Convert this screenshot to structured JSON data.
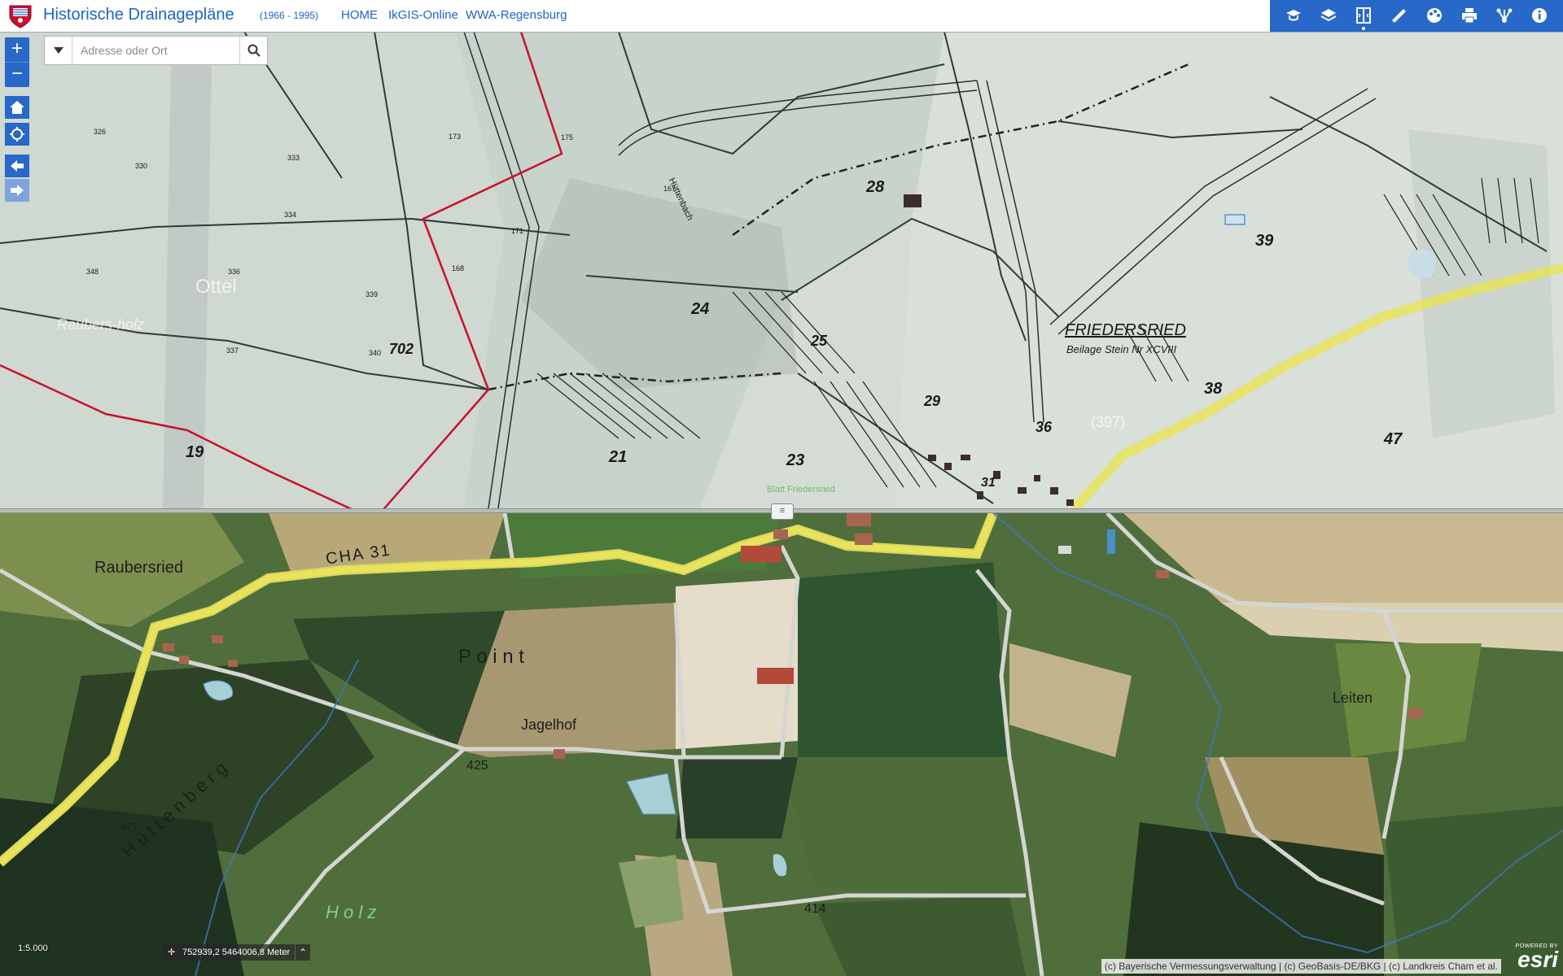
{
  "header": {
    "title": "Historische Drainagepläne",
    "subtitle": "(1966 - 1995)",
    "links": [
      "HOME",
      "IkGIS-Online",
      "WWA-Regensburg"
    ]
  },
  "toolbar": {
    "icons": [
      "legend-icon",
      "layers-icon",
      "swipe-icon",
      "measure-icon",
      "basemap-icon",
      "print-icon",
      "share-icon",
      "info-icon"
    ]
  },
  "search": {
    "placeholder": "Adresse oder Ort"
  },
  "zoom": {
    "in": "+",
    "out": "−"
  },
  "map_top": {
    "labels": [
      "FRIEDERSRIED",
      "Beilage Stein Nr XCVIII",
      "702",
      "24",
      "28",
      "29",
      "36",
      "39",
      "38",
      "47",
      "23",
      "21",
      "19",
      "25",
      "31",
      "Hüttenbach",
      "Ottel",
      "Raubers-holz",
      "(397)",
      "Blatt Friedersried"
    ],
    "parcels": [
      "326",
      "330",
      "333",
      "334",
      "336",
      "339",
      "340",
      "337",
      "348",
      "173",
      "171",
      "175",
      "168",
      "167"
    ]
  },
  "map_bottom": {
    "labels": [
      "Raubersried",
      "CHA 31",
      "P o i n t",
      "Jagelhof",
      "425",
      "414",
      "Leiten",
      "H ü t t e n b e r g",
      "H o l z",
      "477"
    ]
  },
  "status": {
    "scale": "1:5.000",
    "coordinates": "752939,2 5464006,8 Meter",
    "attribution": "(c) Bayerische Vermessungsverwaltung | (c) GeoBasis-DE/BKG | (c) Landkreis Cham et al.",
    "esri_powered": "POWERED BY",
    "esri_word": "esri"
  },
  "colors": {
    "accent": "#2768c9",
    "road_yellow": "#e8e35a",
    "parcel_red": "#c8102e"
  }
}
